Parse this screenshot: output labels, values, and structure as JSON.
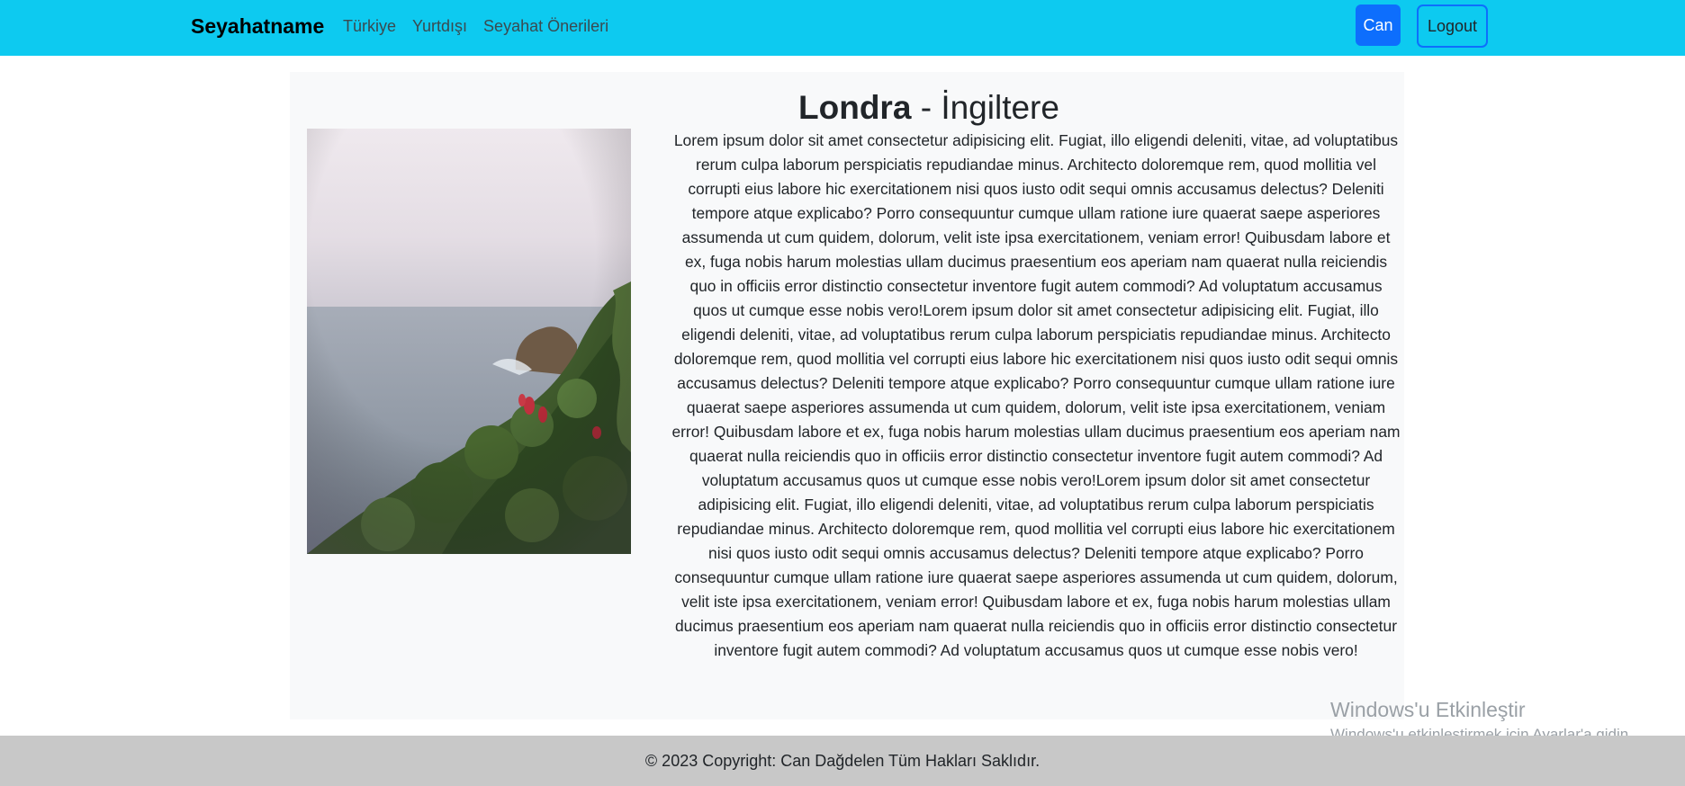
{
  "navbar": {
    "brand": "Seyahatname",
    "links": [
      "Türkiye",
      "Yurtdışı",
      "Seyahat Önerileri"
    ],
    "user_button": "Can",
    "logout_button": "Logout",
    "background_color": "#0dcaf0",
    "accent_color": "#0d6efd"
  },
  "article": {
    "city": "Londra",
    "separator": "-",
    "country": "İngiltere",
    "image_icon": "landscape-photo",
    "body": "Lorem ipsum dolor sit amet consectetur adipisicing elit. Fugiat, illo eligendi deleniti, vitae, ad voluptatibus rerum culpa laborum perspiciatis repudiandae minus. Architecto doloremque rem, quod mollitia vel corrupti eius labore hic exercitationem nisi quos iusto odit sequi omnis accusamus delectus? Deleniti tempore atque explicabo? Porro consequuntur cumque ullam ratione iure quaerat saepe asperiores assumenda ut cum quidem, dolorum, velit iste ipsa exercitationem, veniam error! Quibusdam labore et ex, fuga nobis harum molestias ullam ducimus praesentium eos aperiam nam quaerat nulla reiciendis quo in officiis error distinctio consectetur inventore fugit autem commodi? Ad voluptatum accusamus quos ut cumque esse nobis vero!Lorem ipsum dolor sit amet consectetur adipisicing elit. Fugiat, illo eligendi deleniti, vitae, ad voluptatibus rerum culpa laborum perspiciatis repudiandae minus. Architecto doloremque rem, quod mollitia vel corrupti eius labore hic exercitationem nisi quos iusto odit sequi omnis accusamus delectus? Deleniti tempore atque explicabo? Porro consequuntur cumque ullam ratione iure quaerat saepe asperiores assumenda ut cum quidem, dolorum, velit iste ipsa exercitationem, veniam error! Quibusdam labore et ex, fuga nobis harum molestias ullam ducimus praesentium eos aperiam nam quaerat nulla reiciendis quo in officiis error distinctio consectetur inventore fugit autem commodi? Ad voluptatum accusamus quos ut cumque esse nobis vero!Lorem ipsum dolor sit amet consectetur adipisicing elit. Fugiat, illo eligendi deleniti, vitae, ad voluptatibus rerum culpa laborum perspiciatis repudiandae minus. Architecto doloremque rem, quod mollitia vel corrupti eius labore hic exercitationem nisi quos iusto odit sequi omnis accusamus delectus? Deleniti tempore atque explicabo? Porro consequuntur cumque ullam ratione iure quaerat saepe asperiores assumenda ut cum quidem, dolorum, velit iste ipsa exercitationem, veniam error! Quibusdam labore et ex, fuga nobis harum molestias ullam ducimus praesentium eos aperiam nam quaerat nulla reiciendis quo in officiis error distinctio consectetur inventore fugit autem commodi? Ad voluptatum accusamus quos ut cumque esse nobis vero!"
  },
  "watermark": {
    "title": "Windows'u Etkinleştir",
    "subtitle": "Windows'u etkinleştirmek için Ayarlar'a gidin."
  },
  "footer": {
    "text": "© 2023 Copyright: Can Dağdelen Tüm Hakları Saklıdır.",
    "background_color": "#c8c8c8"
  }
}
